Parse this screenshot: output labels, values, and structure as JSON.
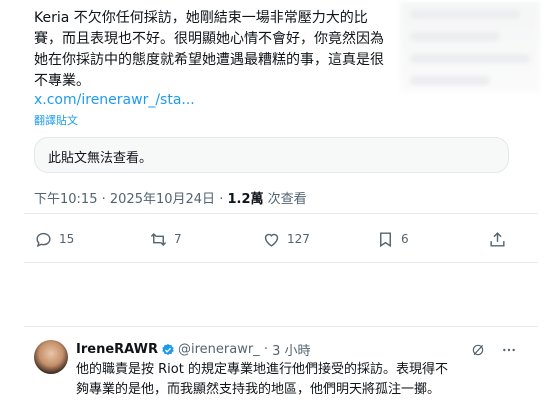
{
  "quoted_post": {
    "text": "Keria 不欠你任何採訪，她剛結束一場非常壓力大的比賽，而且表現也不好。很明顯她心情不會好，你竟然因為她在你採訪中的態度就希望她遭遇最糟糕的事，這真是很不專業。",
    "link": "x.com/irenerawr_/sta...",
    "translate_label": "翻譯貼文",
    "unavailable_notice": "此貼文無法查看。"
  },
  "post_meta": {
    "time": "下午10:15",
    "separator": "·",
    "date": "2025年10月24日",
    "views_count": "1.2萬",
    "views_label": "次查看"
  },
  "actions": {
    "replies": "15",
    "reposts": "7",
    "likes": "127",
    "bookmarks": "6"
  },
  "reply": {
    "name": "IreneRAWR",
    "handle": "@irenerawr_",
    "separator": "·",
    "time": "3 小時",
    "text": "他的職責是按 Riot 的規定專業地進行他們接受的採訪。表現得不夠專業的是他，而我顯然支持我的地區，他們明天將孤注一擲。"
  },
  "icons": {
    "reply": "comment-icon",
    "repost": "repost-icon",
    "like": "heart-icon",
    "bookmark": "bookmark-icon",
    "share": "share-icon",
    "verified": "verified-badge-icon",
    "more": "more-icon",
    "grok": "grok-icon"
  },
  "colors": {
    "link": "#1d9bf0",
    "secondary_text": "#536471",
    "verified": "#1d9bf0"
  }
}
